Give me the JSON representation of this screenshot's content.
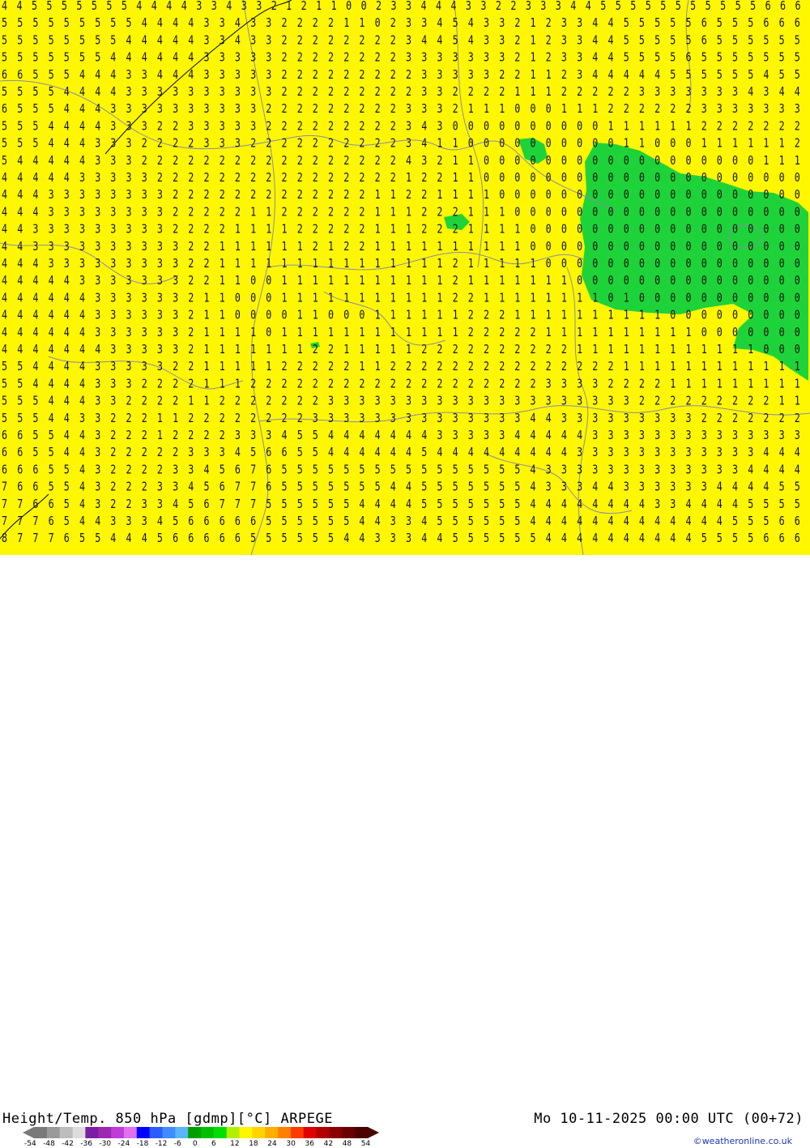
{
  "title": "Height/Temp. 850 hPa [gdmp][°C] ARPEGE",
  "time": "Mo 10-11-2025 00:00 UTC (00+72)",
  "credit": "©weatheronline.co.uk",
  "scale": {
    "ticks": [
      "-54",
      "-48",
      "-42",
      "-36",
      "-30",
      "-24",
      "-18",
      "-12",
      "-6",
      "0",
      "6",
      "12",
      "18",
      "24",
      "30",
      "36",
      "42",
      "48",
      "54"
    ],
    "colors": [
      "#7a7a7a",
      "#9a9a9a",
      "#bdbdbd",
      "#dcdcdc",
      "#7b1fa2",
      "#9c27b0",
      "#c03bd8",
      "#e070f0",
      "#0000ff",
      "#2a5cff",
      "#3f8cff",
      "#5ab4ff",
      "#00a000",
      "#00c000",
      "#00e000",
      "#b0f000",
      "#fff700",
      "#ffd400",
      "#ffae00",
      "#ff8000",
      "#ff3c00",
      "#e00000",
      "#b00000",
      "#8a0000",
      "#6a0000",
      "#4a0000"
    ]
  },
  "palette": {
    "background": "#fff700",
    "zero_zone": "#1ed33a",
    "numbers": "#111111",
    "borders": "#8a8aa8"
  },
  "field": {
    "rows": [
      "4 4 5 5 5 5 5 5 5 4 4 4 4 3 3 4 3 3 2 1 2 1 1 0 0 2 3 3 4 4 4 3 3 2 2 3 3 3 4 4 5 5 5 5 5 5 5 5 5 5 5 6 6 6",
      "5 5 5 5 5 5 5 5 5 4 4 4 4 3 3 4 3 3 2 2 2 2 1 1 0 2 3 3 4 5 4 3 3 2 1 2 3 3 4 4 5 5 5 5 5 6 5 5 5 6 6 6",
      "5 5 5 5 5 5 5 5 4 4 4 4 4 3 3 4 3 3 2 2 2 2 2 2 2 2 3 4 4 5 4 3 3 2 1 2 3 3 4 4 5 5 5 5 5 6 5 5 5 5 5 5",
      "5 5 5 5 5 5 5 4 4 4 4 4 4 3 3 3 3 3 2 2 2 2 2 2 2 2 3 3 3 3 3 3 3 2 1 2 3 3 4 4 5 5 5 5 6 5 5 5 5 5 5 5",
      "6 6 5 5 5 4 4 4 3 3 4 4 4 3 3 3 3 3 2 2 2 2 2 2 2 2 2 3 3 3 3 3 2 2 1 1 2 3 4 4 4 4 4 5 5 5 5 5 5 4 5 5",
      "5 5 5 5 4 4 4 4 3 3 3 3 3 3 3 3 3 3 2 2 2 2 2 2 2 2 2 3 3 2 2 2 2 1 1 1 2 2 2 2 2 3 3 3 3 3 3 3 4 3 4 4",
      "6 5 5 5 4 4 4 3 3 3 3 3 3 3 3 3 3 2 2 2 2 2 2 2 2 2 3 3 3 2 1 1 1 0 0 0 1 1 1 2 2 2 2 2 2 3 3 3 3 3 3 3",
      "5 5 5 4 4 4 4 3 3 3 2 2 3 3 3 3 3 2 2 2 2 2 2 2 2 2 3 4 3 0 0 0 0 0 0 0 0 0 0 1 1 1 1 1 1 2 2 2 2 2 2 2",
      "5 5 5 4 4 4 3 3 3 2 2 2 2 3 3 3 2 2 2 2 2 2 2 2 2 2 3 4 1 1 0 0 0 0 0 0 0 0 0 0 1 1 0 0 0 1 1 1 1 1 1 2",
      "5 4 4 4 4 4 3 3 3 2 2 2 2 2 2 2 2 2 2 2 2 2 2 2 2 2 4 3 2 1 1 0 0 0 0 0 0 0 0 0 0 0 0 0 0 0 0 0 0 1 1 1",
      "4 4 4 4 4 3 3 3 3 3 2 2 2 2 2 2 2 2 2 2 2 2 2 2 2 2 1 2 2 1 1 0 0 0 0 0 0 0 0 0 0 0 0 0 0 0 0 0 0 0 0 0",
      "4 4 4 3 3 3 3 3 3 3 3 2 2 2 2 2 2 2 2 2 2 2 2 2 1 1 2 2 1 1 1 1 0 0 0 0 0 0 0 0 0 0 0 0 0 0 0 0 0 0 0 0",
      "4 4 4 3 3 3 3 3 3 3 3 2 2 2 2 2 1 1 2 2 2 2 2 2 1 1 1 2 2 2 1 1 1 0 0 0 0 0 0 0 0 0 0 0 0 0 0 0 0 0 0 0",
      "4 4 3 3 3 3 3 3 3 3 3 2 2 2 2 1 1 1 1 2 2 2 2 2 1 1 1 2 2 2 1 1 1 1 0 0 0 0 0 0 0 0 0 0 0 0 0 0 0 0 0 0",
      "4 4 3 3 3 3 3 3 3 3 3 3 2 2 1 1 1 1 1 1 2 1 2 2 1 1 1 1 1 1 1 1 1 1 0 0 0 0 0 0 0 0 0 0 0 0 0 0 0 0 0 0",
      "4 4 4 3 3 3 3 3 3 3 3 3 2 2 1 1 1 1 1 1 1 1 1 1 1 1 1 1 1 2 1 1 1 1 1 0 0 0 0 0 0 0 0 0 0 0 0 0 0 0 0 0",
      "4 4 4 4 4 3 3 3 3 3 3 3 2 2 1 1 0 0 1 1 1 1 1 1 1 1 1 1 1 2 1 1 1 1 1 1 1 0 0 0 0 0 0 0 0 0 0 0 0 0 0 0",
      "4 4 4 4 4 4 3 3 3 3 3 3 2 1 1 0 0 0 1 1 1 1 1 1 1 1 1 1 1 2 2 1 1 1 1 1 1 1 1 0 1 0 0 0 0 0 0 0 0 0 0 0",
      "4 4 4 4 4 4 3 3 3 3 3 3 2 1 1 0 0 0 0 1 1 0 0 0 1 1 1 1 1 1 2 2 2 1 1 1 1 1 1 1 1 1 1 0 0 0 0 0 0 0 0 0",
      "4 4 4 4 4 4 3 3 3 3 3 3 2 1 1 1 1 0 1 1 1 1 1 1 1 1 1 1 1 1 2 2 2 2 2 1 1 1 1 1 1 1 1 1 1 0 0 0 0 0 0 0",
      "4 4 4 4 4 4 4 3 3 3 3 3 2 1 1 1 1 1 1 1 2 2 1 1 1 1 1 2 2 2 2 2 2 2 2 2 2 1 1 1 1 1 1 1 1 1 1 1 1 0 0 0",
      "5 5 4 4 4 4 3 3 3 3 3 2 2 1 1 1 1 1 2 2 2 2 2 1 1 2 2 2 2 2 2 2 2 2 2 2 2 2 2 2 1 1 1 1 1 1 1 1 1 1 1 1",
      "5 5 4 4 4 4 3 3 3 2 2 2 2 1 1 1 2 2 2 2 2 2 2 2 2 2 2 2 2 2 2 2 2 2 2 3 3 3 3 2 2 2 2 1 1 1 1 1 1 1 1 1",
      "5 5 5 4 4 4 3 3 2 2 2 2 1 1 2 2 2 2 2 2 2 3 3 3 3 3 3 3 3 3 3 3 3 3 3 3 3 3 3 3 3 2 2 2 2 2 2 2 2 2 1 1",
      "5 5 5 4 4 3 3 2 2 2 1 1 2 2 2 2 2 2 2 2 3 3 3 3 3 3 3 3 3 3 3 3 3 3 4 4 3 3 3 3 3 3 3 3 3 2 2 2 2 2 2 2",
      "6 6 5 5 4 4 3 2 2 2 1 2 2 2 2 3 3 3 4 5 5 4 4 4 4 4 4 4 3 3 3 3 3 4 4 4 4 4 3 3 3 3 3 3 3 3 3 3 3 3 3 3",
      "6 6 5 5 4 4 3 2 2 2 2 2 3 3 3 4 5 6 6 5 5 4 4 4 4 4 4 5 4 4 4 4 4 4 4 4 4 3 3 3 3 3 3 3 3 3 3 3 3 4 4 4",
      "6 6 6 5 5 4 3 2 2 2 2 3 3 4 5 6 7 6 5 5 5 5 5 5 5 5 5 5 5 5 5 5 5 5 4 3 3 3 3 3 3 3 3 3 3 3 3 3 4 4 4 4",
      "7 6 6 5 5 4 3 2 2 2 3 3 4 5 6 7 7 6 5 5 5 5 5 5 5 4 4 5 5 5 5 5 5 5 4 3 3 3 4 4 3 3 3 3 3 3 4 4 4 4 5 5",
      "7 7 6 6 5 4 3 2 2 3 3 4 5 6 7 7 7 5 5 5 5 5 5 4 4 4 4 5 5 5 5 5 5 5 4 4 4 4 4 4 4 4 3 3 4 4 4 4 5 5 5 5",
      "7 7 7 6 5 4 4 3 3 3 4 5 6 6 6 6 6 5 5 5 5 5 5 4 4 3 3 4 5 5 5 5 5 5 4 4 4 4 4 4 4 4 4 4 4 4 4 5 5 5 6 6",
      "8 7 7 7 6 5 5 4 4 4 5 6 6 6 6 6 5 5 5 5 5 5 4 4 3 3 3 4 4 5 5 5 5 5 5 4 4 4 4 4 4 4 4 4 4 5 5 5 5 6 6 6"
    ]
  }
}
